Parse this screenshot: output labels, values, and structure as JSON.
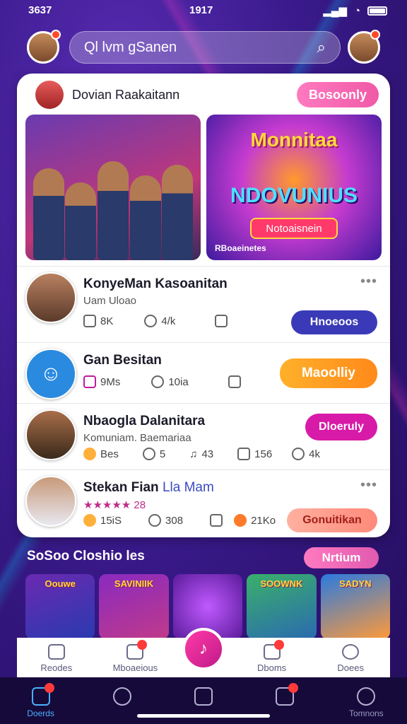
{
  "status": {
    "time_left": "3637",
    "time": "1917"
  },
  "search": {
    "value": "Ql lvm gSanen"
  },
  "featured": {
    "title": "Dovian Raakaitann",
    "button": "Bosoonly",
    "banner2": {
      "headline": "Monnitaa",
      "subheadline": "NDOVUNIUS",
      "button": "Notoaisnein",
      "caption": "RBoaeinetes"
    }
  },
  "rows": [
    {
      "name": "KonyeMan Kasoanitan",
      "sub": "Uam Uloao",
      "stats": [
        {
          "icon": "share-icon",
          "value": "8K"
        },
        {
          "icon": "heart-icon",
          "value": "4/k"
        },
        {
          "icon": "share-icon",
          "value": ""
        }
      ],
      "button": "Hnoeoos",
      "button_color": "#3a3ab8"
    },
    {
      "name": "Gan Besitan",
      "sub": "",
      "stats": [
        {
          "icon": "message-icon",
          "value": "9Ms"
        },
        {
          "icon": "heart-icon",
          "value": "10ia"
        },
        {
          "icon": "share-icon",
          "value": ""
        }
      ],
      "button": "Maoolliy",
      "button_color": "#ff9a1a"
    },
    {
      "name": "Nbaogla Dalanitara",
      "sub": "Komuniam.  Baemariaa",
      "stats": [
        {
          "icon": "coin-icon",
          "value": "Bes"
        },
        {
          "icon": "heart-icon",
          "value": "5"
        },
        {
          "icon": "music-icon",
          "value": "43"
        },
        {
          "icon": "share-icon",
          "value": "156"
        },
        {
          "icon": "heart-icon",
          "value": "4k"
        }
      ],
      "button": "Dloeruly",
      "button_color": "#d81aa8"
    },
    {
      "name": "Stekan Fian",
      "name_extra": "Lla Mam",
      "sub": "★★★★★ 28",
      "stats": [
        {
          "icon": "coin-icon",
          "value": "15iS"
        },
        {
          "icon": "heart-icon",
          "value": "308"
        },
        {
          "icon": "share-icon",
          "value": ""
        },
        {
          "icon": "emoji-icon",
          "value": "21Ko"
        }
      ],
      "button": "Gonuitikan",
      "button_color": "#ff8a7a"
    }
  ],
  "section": {
    "title": "SoSoo Closhio les",
    "button": "Nrtium"
  },
  "thumbs": [
    {
      "text": "Oouwe"
    },
    {
      "text": "SAVINIIK"
    },
    {
      "text": ""
    },
    {
      "text": "SOOWNK"
    },
    {
      "text": "SADYN"
    }
  ],
  "tabs_top": [
    {
      "label": "Reodes"
    },
    {
      "label": "Mboaeious"
    },
    {
      "label": "Dboms"
    },
    {
      "label": "Doees"
    }
  ],
  "tabs_bottom": [
    {
      "label": "Doerds"
    },
    {
      "label": ""
    },
    {
      "label": ""
    },
    {
      "label": ""
    },
    {
      "label": "Tomnons"
    }
  ]
}
